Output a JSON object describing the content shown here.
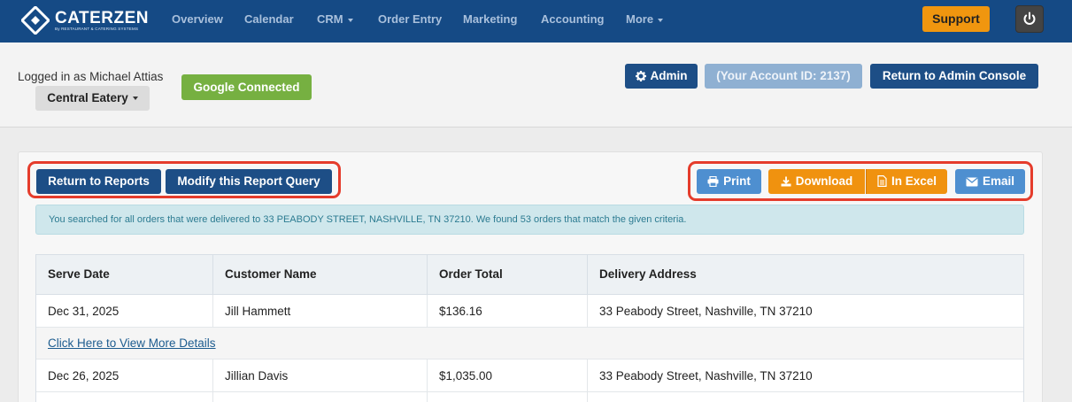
{
  "brand": {
    "name": "CATERZEN",
    "sub": "By RESTAURANT & CATERING SYSTEMS"
  },
  "nav": {
    "items": [
      {
        "label": "Overview"
      },
      {
        "label": "Calendar"
      },
      {
        "label": "CRM"
      },
      {
        "label": "Order Entry"
      },
      {
        "label": "Marketing"
      },
      {
        "label": "Accounting"
      },
      {
        "label": "More"
      }
    ],
    "support_label": "Support",
    "power_icon": "power-icon"
  },
  "header": {
    "logged_in_text": "Logged in as Michael Attias",
    "location_label": "Central Eatery",
    "google_label": "Google Connected",
    "admin_label": "Admin",
    "account_id_label": "(Your Account ID: 2137)",
    "console_label": "Return to Admin Console"
  },
  "toolbar": {
    "return_label": "Return to Reports",
    "modify_label": "Modify this Report Query",
    "print_label": "Print",
    "download_label": "Download",
    "excel_label": "In Excel",
    "email_label": "Email"
  },
  "info_message": "You searched for all orders that were delivered to 33 PEABODY STREET, NASHVILLE, TN 37210. We found 53 orders that match the given criteria.",
  "table": {
    "headers": [
      "Serve Date",
      "Customer Name",
      "Order Total",
      "Delivery Address"
    ],
    "rows": [
      [
        "Dec 31, 2025",
        "Jill Hammett",
        "$136.16",
        "33 Peabody Street, Nashville, TN 37210"
      ],
      [
        "Dec 26, 2025",
        "Jillian Davis",
        "$1,035.00",
        "33 Peabody Street, Nashville, TN 37210"
      ]
    ],
    "detail_link": "Click Here to View More Details"
  },
  "colors": {
    "nav_bg": "#154a85",
    "accent_orange": "#f0960f",
    "highlight_red": "#e53c2c",
    "google_green": "#76b041"
  }
}
